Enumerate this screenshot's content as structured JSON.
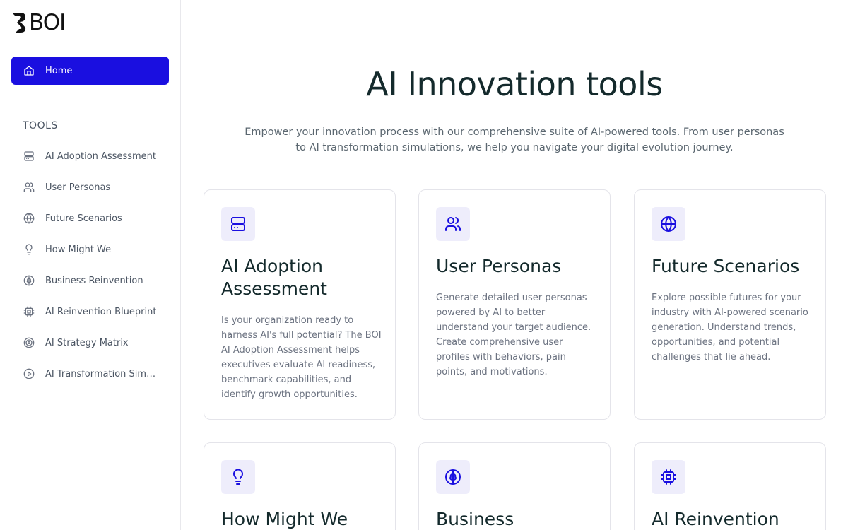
{
  "brand": {
    "logo_text": "BOI",
    "accent_color": "#1a0fe0"
  },
  "sidebar": {
    "home": {
      "label": "Home",
      "icon": "home-icon"
    },
    "tools_heading": "TOOLS",
    "items": [
      {
        "label": "AI Adoption Assessment",
        "icon": "server-icon"
      },
      {
        "label": "User Personas",
        "icon": "users-icon"
      },
      {
        "label": "Future Scenarios",
        "icon": "globe-icon"
      },
      {
        "label": "How Might We",
        "icon": "lightbulb-icon"
      },
      {
        "label": "Business Reinvention",
        "icon": "brain-icon"
      },
      {
        "label": "AI Reinvention Blueprint",
        "icon": "cpu-icon"
      },
      {
        "label": "AI Strategy Matrix",
        "icon": "target-icon"
      },
      {
        "label": "AI Transformation Simu...",
        "icon": "play-circle-icon"
      }
    ]
  },
  "main": {
    "title": "AI Innovation tools",
    "subtitle": "Empower your innovation process with our comprehensive suite of AI-powered tools. From user personas to AI transformation simulations, we help you navigate your digital evolution journey.",
    "cards": [
      {
        "title": "AI Adoption Assessment",
        "description": "Is your organization ready to harness AI's full potential? The BOI AI Adoption Assessment helps executives evaluate AI readiness, benchmark capabilities, and identify growth opportunities.",
        "icon": "server-icon"
      },
      {
        "title": "User Personas",
        "description": "Generate detailed user personas powered by AI to better understand your target audience. Create comprehensive user profiles with behaviors, pain points, and motivations.",
        "icon": "users-icon"
      },
      {
        "title": "Future Scenarios",
        "description": "Explore possible futures for your industry with AI-powered scenario generation. Understand trends, opportunities, and potential challenges that lie ahead.",
        "icon": "globe-icon"
      },
      {
        "title": "How Might We",
        "description": "",
        "icon": "lightbulb-icon"
      },
      {
        "title": "Business",
        "description": "",
        "icon": "brain-icon"
      },
      {
        "title": "AI Reinvention",
        "description": "",
        "icon": "cpu-icon"
      }
    ]
  }
}
